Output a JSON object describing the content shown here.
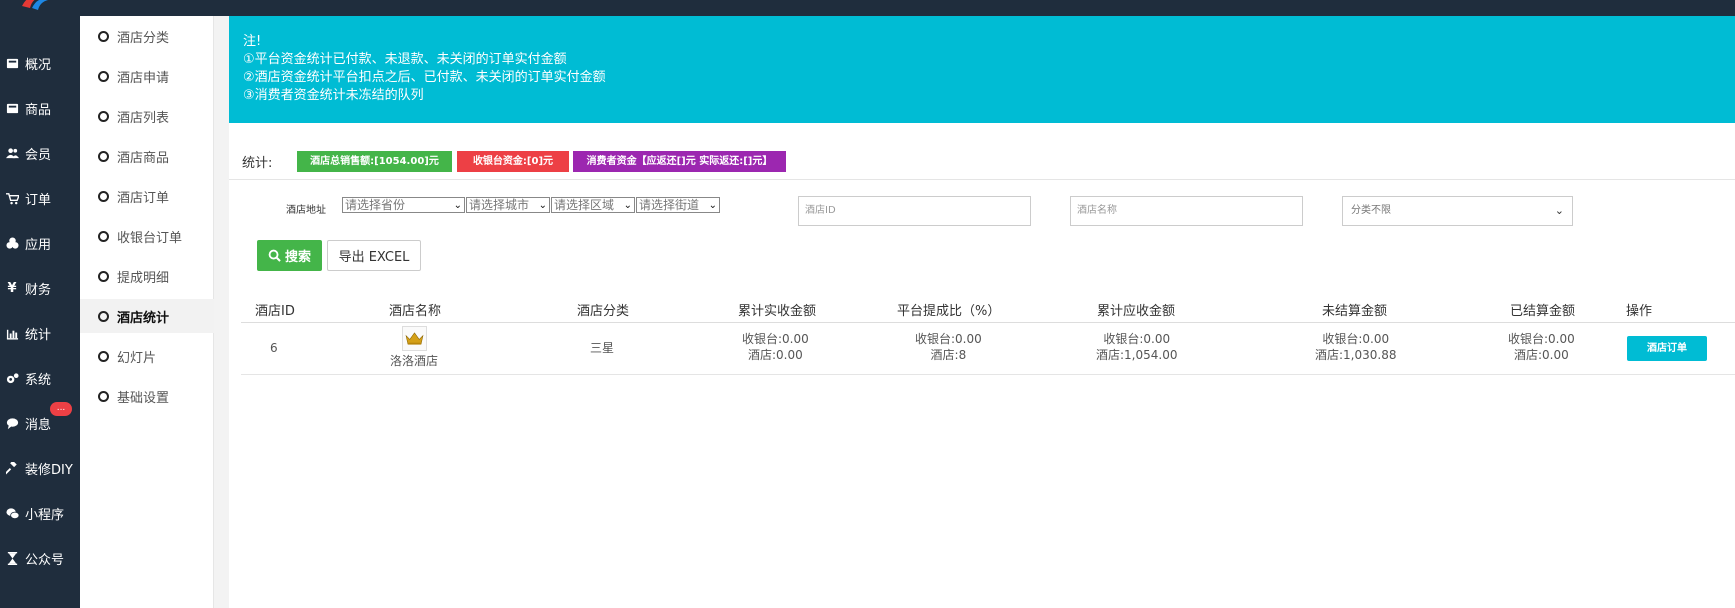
{
  "nav": [
    {
      "label": "概况",
      "icon": "dashboard-icon"
    },
    {
      "label": "商品",
      "icon": "goods-icon"
    },
    {
      "label": "会员",
      "icon": "users-icon"
    },
    {
      "label": "订单",
      "icon": "cart-icon"
    },
    {
      "label": "应用",
      "icon": "apps-icon"
    },
    {
      "label": "财务",
      "icon": "yen-icon"
    },
    {
      "label": "统计",
      "icon": "bar-chart-icon"
    },
    {
      "label": "系统",
      "icon": "gears-icon"
    },
    {
      "label": "消息",
      "icon": "chat-icon"
    },
    {
      "label": "装修DIY",
      "icon": "gavel-icon"
    },
    {
      "label": "小程序",
      "icon": "wechat-icon"
    },
    {
      "label": "公众号",
      "icon": "hourglass-icon"
    }
  ],
  "message_badge": "...",
  "submenu": [
    {
      "label": "酒店分类"
    },
    {
      "label": "酒店申请"
    },
    {
      "label": "酒店列表"
    },
    {
      "label": "酒店商品"
    },
    {
      "label": "酒店订单"
    },
    {
      "label": "收银台订单"
    },
    {
      "label": "提成明细"
    },
    {
      "label": "酒店统计",
      "active": true
    },
    {
      "label": "幻灯片"
    },
    {
      "label": "基础设置"
    }
  ],
  "notice": {
    "title": "注!",
    "lines": [
      "①平台资金统计已付款、未退款、未关闭的订单实付金额",
      "②酒店资金统计平台扣点之后、已付款、未关闭的订单实付金额",
      "③消费者资金统计未冻结的队列"
    ]
  },
  "stats": {
    "label": "统计:",
    "tags": [
      {
        "text": "酒店总销售额:[1054.00]元",
        "color": "#44b549"
      },
      {
        "text": "收银台资金:[0]元",
        "color": "#ed4045"
      },
      {
        "text": "消费者资金【应返还[]元 实际返还:[]元】",
        "color": "#9c27b0"
      }
    ]
  },
  "filters": {
    "address_label": "酒店地址",
    "province": "请选择省份",
    "city": "请选择城市",
    "area": "请选择区域",
    "street": "请选择街道",
    "hotel_id_placeholder": "酒店ID",
    "hotel_name_placeholder": "酒店名称",
    "category": "分类不限",
    "search_label": "搜索",
    "export_label": "导出 EXCEL"
  },
  "table": {
    "headers": [
      "酒店ID",
      "酒店名称",
      "酒店分类",
      "累计实收金额",
      "平台提成比（%）",
      "累计应收金额",
      "未结算金额",
      "已结算金额",
      "操作"
    ],
    "rows": [
      {
        "id": "6",
        "name": "洛洛酒店",
        "category": "三星",
        "actual_received": [
          "收银台:0.00",
          "酒店:0.00"
        ],
        "commission": [
          "收银台:0.00",
          "酒店:8"
        ],
        "receivable": [
          "收银台:0.00",
          "酒店:1,054.00"
        ],
        "unsettled": [
          "收银台:0.00",
          "酒店:1,030.88"
        ],
        "settled": [
          "收银台:0.00",
          "酒店:0.00"
        ],
        "action": "酒店订单"
      }
    ]
  }
}
